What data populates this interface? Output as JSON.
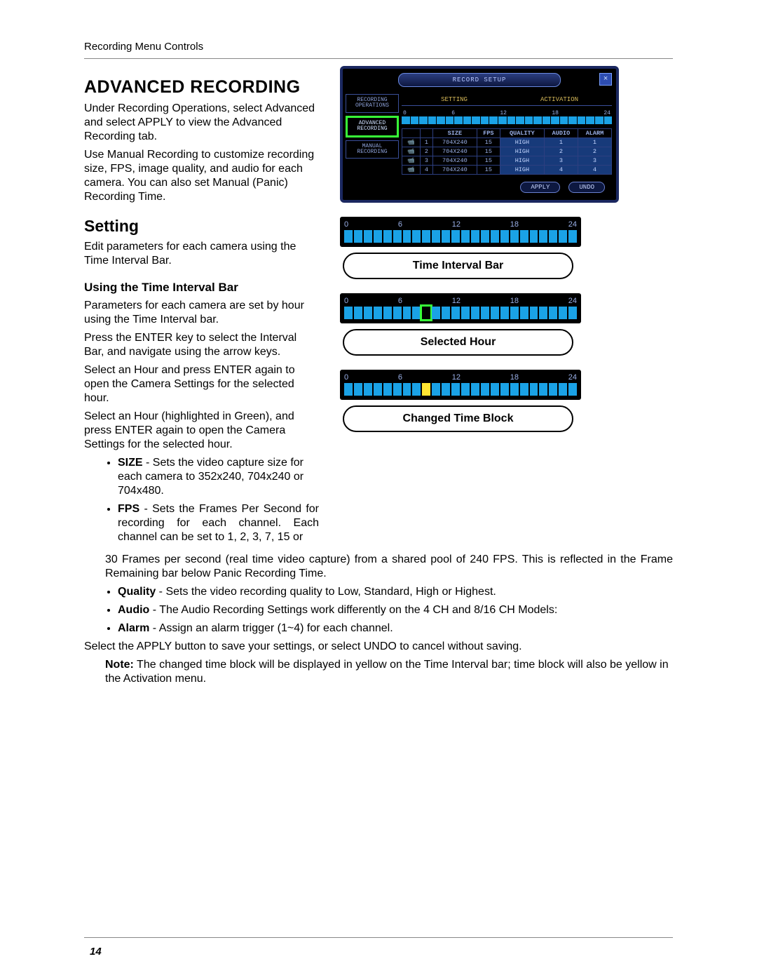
{
  "header": {
    "running_head": "Recording Menu Controls",
    "page_number": "14"
  },
  "titles": {
    "h1": "ADVANCED RECORDING",
    "h2": "Setting",
    "h3": "Using the Time Interval Bar"
  },
  "paragraphs": {
    "intro1": "Under Recording Operations, select Advanced and select APPLY to view the Advanced Recording tab.",
    "intro2": "Use Manual Recording to customize recording size, FPS, image quality, and audio for each camera. You can also set Manual (Panic) Recording Time.",
    "setting": "Edit parameters for each camera using the Time Interval Bar.",
    "using1": "Parameters for each camera are set by hour using the Time Interval bar.",
    "using2": "Press the ENTER key to select the Interval Bar, and navigate using the arrow keys.",
    "using3": "Select an Hour and press ENTER again to open the Camera Settings for the selected hour.",
    "using4": "Select an Hour (highlighted in Green), and press ENTER again to open the Camera Settings for the selected hour.",
    "after_bullets": "Select the APPLY button to save your settings, or select UNDO to cancel without saving.",
    "note_label": "Note:",
    "note_text": " The changed time block will be displayed in yellow on the Time Interval bar; time block will also be yellow in the Activation menu."
  },
  "bullets": {
    "size_label": "SIZE",
    "size_text": " - Sets the video capture size for each camera to 352x240, 704x240 or 704x480.",
    "fps_label": "FPS",
    "fps_text_a": " - Sets the Frames Per Second for recording for each channel. Each channel can be set to 1, 2, 3, 7, 15 or ",
    "fps_text_b": "30 Frames per second (real time video capture) from a shared pool of 240 FPS. This is reflected in the Frame Remaining bar below Panic Recording Time.",
    "quality_label": "Quality",
    "quality_text": " - Sets the video recording quality to Low, Standard, High or Highest.",
    "audio_label": "Audio",
    "audio_text": " - The Audio Recording Settings work differently on the 4 CH and 8/16 CH Models:",
    "alarm_label": "Alarm",
    "alarm_text": " - Assign an alarm trigger (1~4) for each channel."
  },
  "dvr": {
    "title": "RECORD SETUP",
    "tabs": [
      "RECORDING OPERATIONS",
      "ADVANCED RECORDING",
      "MANUAL RECORDING"
    ],
    "subtabs": [
      "SETTING",
      "ACTIVATION"
    ],
    "scale": [
      "0",
      "6",
      "12",
      "18",
      "24"
    ],
    "table_headers": [
      "",
      "",
      "SIZE",
      "FPS",
      "QUALITY",
      "AUDIO",
      "ALARM"
    ],
    "rows": [
      {
        "ch": "1",
        "size": "704X240",
        "fps": "15",
        "quality": "HIGH",
        "audio": "1",
        "alarm": "1"
      },
      {
        "ch": "2",
        "size": "704X240",
        "fps": "15",
        "quality": "HIGH",
        "audio": "2",
        "alarm": "2"
      },
      {
        "ch": "3",
        "size": "704X240",
        "fps": "15",
        "quality": "HIGH",
        "audio": "3",
        "alarm": "3"
      },
      {
        "ch": "4",
        "size": "704X240",
        "fps": "15",
        "quality": "HIGH",
        "audio": "4",
        "alarm": "4"
      }
    ],
    "apply": "APPLY",
    "undo": "UNDO"
  },
  "figs": {
    "scale": [
      "0",
      "6",
      "12",
      "18",
      "24"
    ],
    "cap1": "Time Interval Bar",
    "cap2": "Selected Hour",
    "cap3": "Changed Time Block"
  }
}
